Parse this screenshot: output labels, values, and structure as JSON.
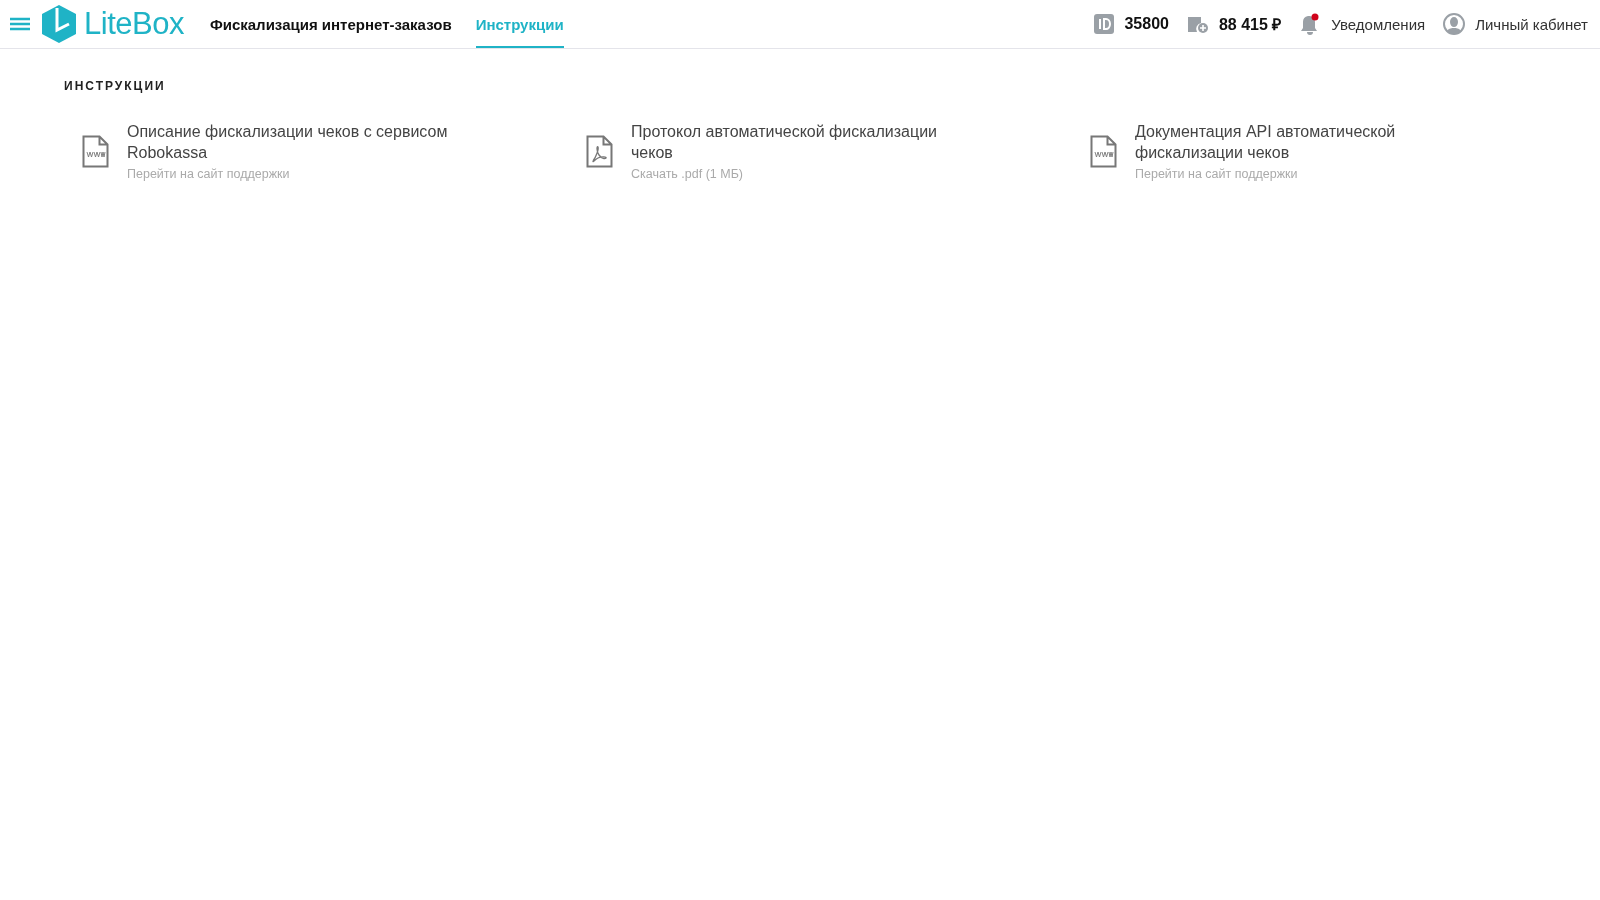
{
  "header": {
    "logo": "LiteBox",
    "nav": [
      {
        "label": "Фискализация интернет-заказов",
        "selected": false
      },
      {
        "label": "Инструкции",
        "selected": true
      }
    ],
    "id": "35800",
    "balance": "88 415 ₽",
    "notifications": {
      "label": "Уведомления",
      "unread": true
    },
    "account": "Личный кабинет"
  },
  "section_title": "ИНСТРУКЦИИ",
  "documents": [
    {
      "kind": "web",
      "title": "Описание фискализации чеков с сервисом Robokassa",
      "link": "Перейти на сайт поддержки"
    },
    {
      "kind": "pdf",
      "title": "Протокол автоматической фискализации чеков",
      "link": "Скачать .pdf (1 МБ)"
    },
    {
      "kind": "web",
      "title": "Документация API автоматической фискализации чеков",
      "link": "Перейти на сайт поддержки"
    }
  ]
}
